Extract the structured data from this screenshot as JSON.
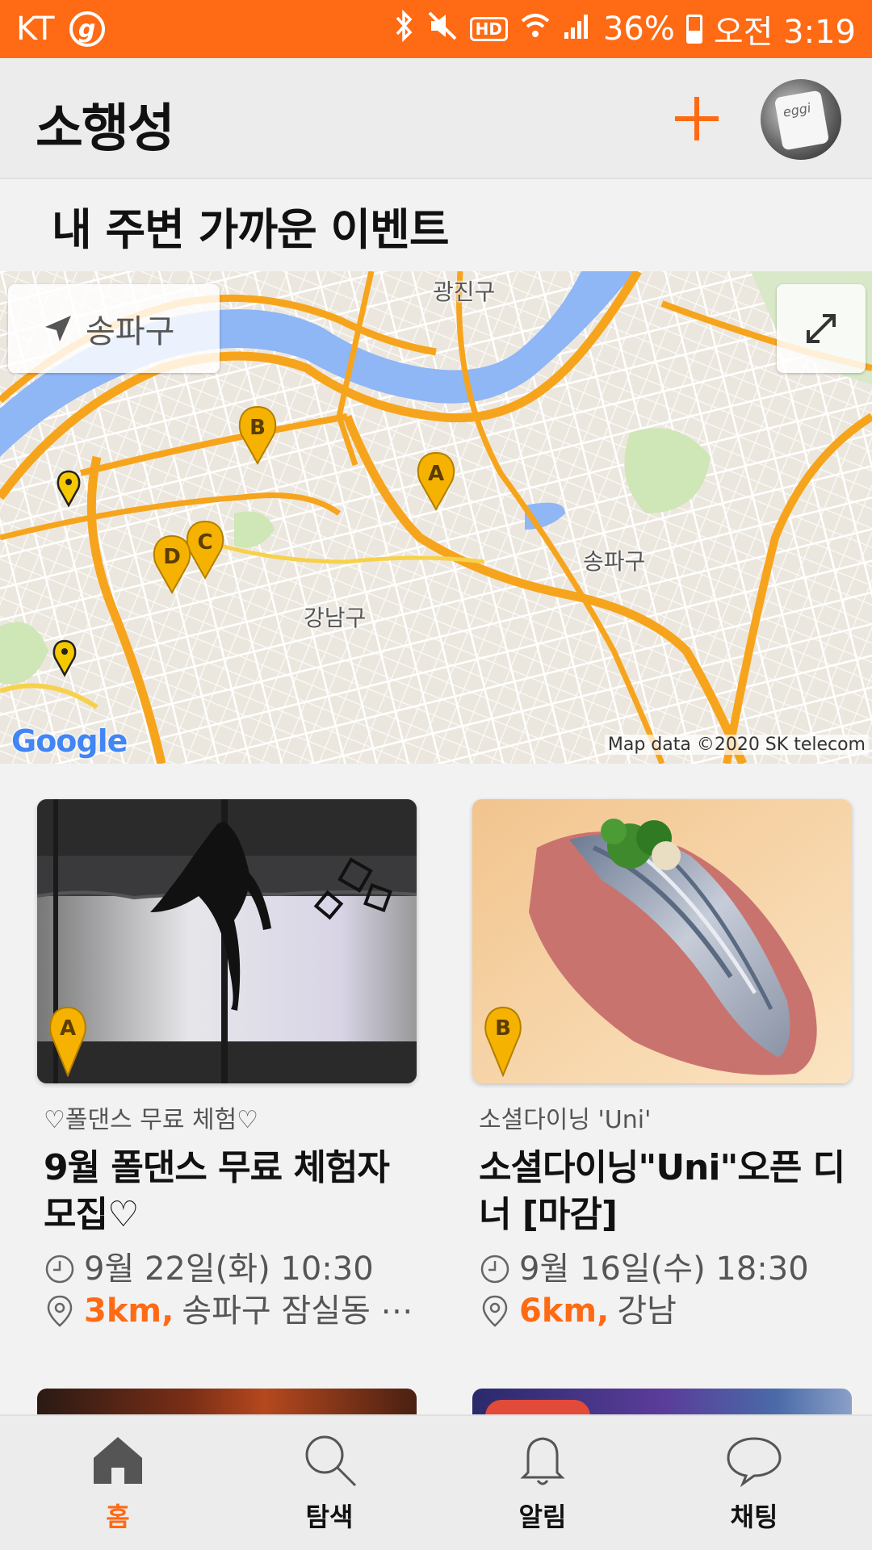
{
  "status_bar": {
    "carrier": "KT",
    "carrier_icon": "g",
    "hd": "HD",
    "battery": "36%",
    "time": "오전 3:19"
  },
  "app_bar": {
    "title": "소행성"
  },
  "section": {
    "title": "내 주변 가까운 이벤트"
  },
  "map": {
    "location_button_label": "송파구",
    "logo": "Google",
    "attribution": "Map data ©2020 SK telecom",
    "labels": {
      "gwangjin": "광진구",
      "songpa": "송파구",
      "gangnam": "강남구"
    },
    "markers": [
      "A",
      "B",
      "C",
      "D"
    ]
  },
  "cards": [
    {
      "marker": "A",
      "category": "♡폴댄스 무료 체험♡",
      "title": "9월 폴댄스 무료 체험자 모집♡",
      "datetime": "9월 22일(화) 10:30",
      "distance": "3km,",
      "location": "송파구 잠실동 ⋯"
    },
    {
      "marker": "B",
      "category": "소셜다이닝 'Uni'",
      "title": "소셜다이닝\"Uni\"오픈 디너 [마감]",
      "datetime": "9월 16일(수) 18:30",
      "distance": "6km,",
      "location": "강남"
    }
  ],
  "bottom_nav": [
    {
      "label": "홈",
      "active": true
    },
    {
      "label": "탐색",
      "active": false
    },
    {
      "label": "알림",
      "active": false
    },
    {
      "label": "채팅",
      "active": false
    }
  ],
  "colors": {
    "accent": "#ff6a14",
    "marker": "#f5b200",
    "water": "#8fb6f5",
    "road": "#f7a41d"
  }
}
